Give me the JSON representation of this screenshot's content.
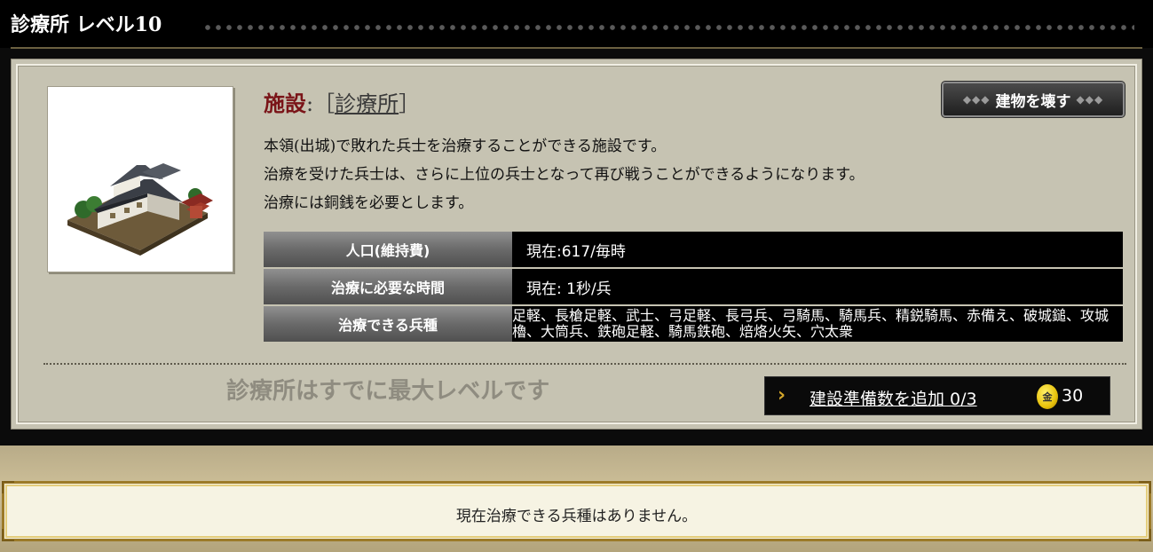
{
  "header": {
    "title": "診療所 レベル10"
  },
  "facility": {
    "label": "施設",
    "colon_bracket_open": ":［",
    "name": "診療所",
    "bracket_close": "］",
    "demolish_button": "建物を壊す",
    "description": [
      "本領(出城)で敗れた兵士を治療することができる施設です。",
      "治療を受けた兵士は、さらに上位の兵士となって再び戦うことができるようになります。",
      "治療には銅銭を必要とします。"
    ],
    "stats": [
      {
        "label": "人口(維持費)",
        "value": "現在:617/毎時"
      },
      {
        "label": "治療に必要な時間",
        "value": "現在: 1秒/兵"
      },
      {
        "label": "治療できる兵種",
        "value": "足軽、長槍足軽、武士、弓足軽、長弓兵、弓騎馬、騎馬兵、精鋭騎馬、赤備え、破城鎚、攻城櫓、大筒兵、鉄砲足軽、騎馬鉄砲、焙烙火矢、穴太衆"
      }
    ],
    "max_level_message": "診療所はすでに最大レベルです",
    "add_prep": {
      "link_text": "建設準備数を追加 0/3",
      "coin_amount": "30",
      "coin_icon": "gold-coin-icon"
    }
  },
  "notice": {
    "text": "現在治療できる兵種はありません。"
  },
  "colors": {
    "title_bg": "#000000",
    "card_bg": "#c6c3b2",
    "facility_label": "#7a1418",
    "notice_border": "#9c7a28"
  }
}
